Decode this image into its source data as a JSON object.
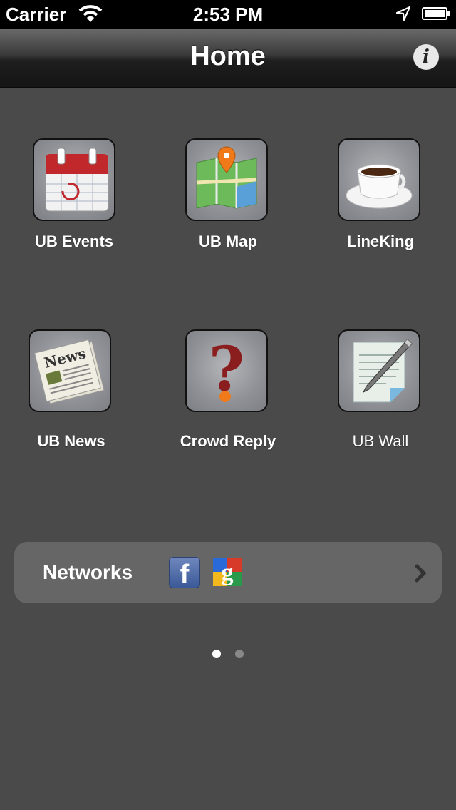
{
  "status_bar": {
    "carrier": "Carrier",
    "time": "2:53 PM"
  },
  "nav": {
    "title": "Home"
  },
  "apps": [
    {
      "label": "UB Events",
      "icon": "calendar-icon"
    },
    {
      "label": "UB Map",
      "icon": "map-icon"
    },
    {
      "label": "LineKing",
      "icon": "coffee-cup-icon"
    },
    {
      "label": "UB News",
      "icon": "newspaper-icon"
    },
    {
      "label": "Crowd Reply",
      "icon": "question-mark-icon"
    },
    {
      "label": "UB Wall",
      "icon": "notepad-pen-icon"
    }
  ],
  "networks": {
    "label": "Networks",
    "icons": [
      "facebook-icon",
      "google-icon"
    ]
  },
  "page_indicator": {
    "pages": 2,
    "current": 1
  },
  "colors": {
    "background": "#4a4a4a",
    "networks_bar": "#666666",
    "facebook": "#3b5998"
  }
}
